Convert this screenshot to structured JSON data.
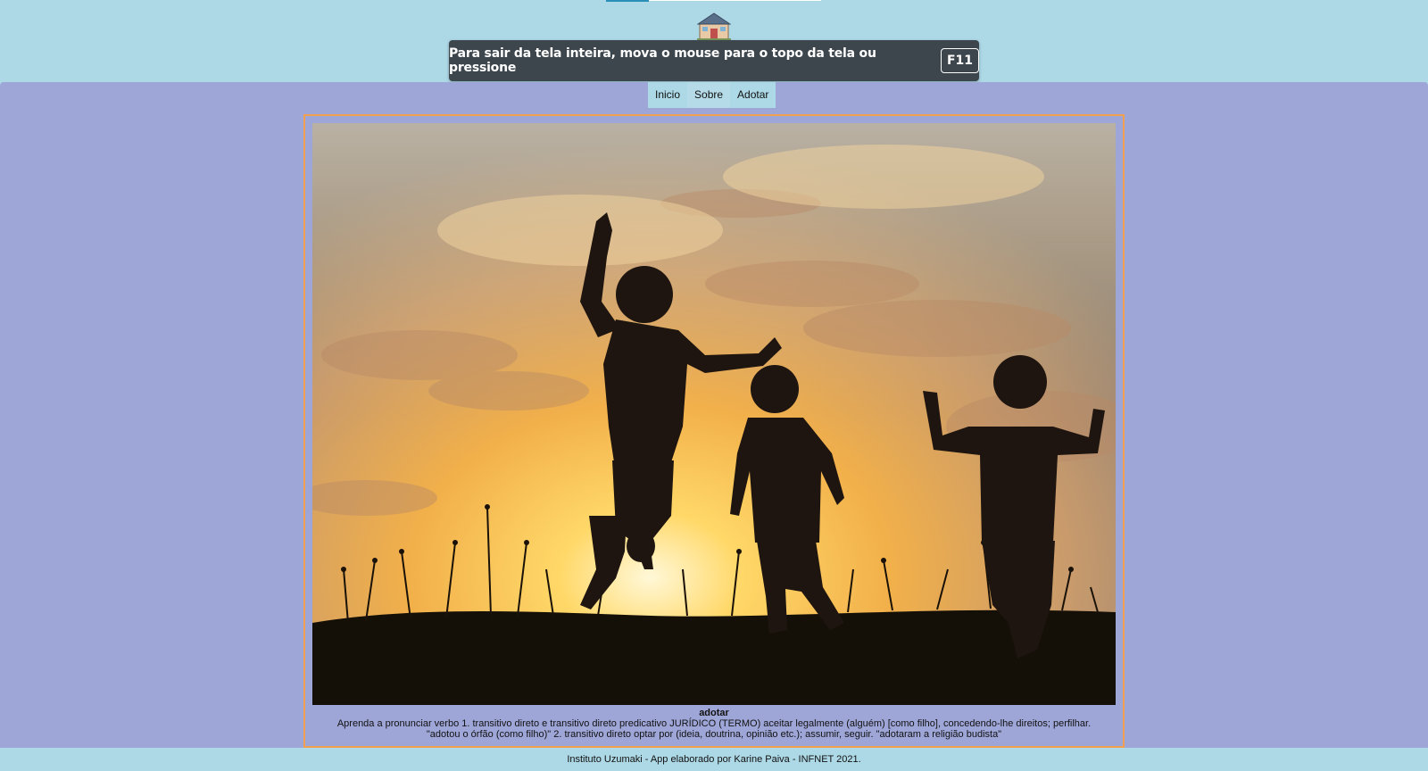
{
  "header": {
    "title": "Instituto Uzumaki",
    "logo_icon": "house-icon"
  },
  "fullscreen_notice": {
    "text": "Para sair da tela inteira, mova o mouse para o topo da tela ou pressione",
    "key": "F11"
  },
  "nav": {
    "items": [
      {
        "label": "Inicio"
      },
      {
        "label": "Sobre"
      },
      {
        "label": "Adotar"
      }
    ]
  },
  "hero": {
    "image": "children-silhouette-sunset-image"
  },
  "caption": {
    "title": "adotar",
    "text": "Aprenda a pronunciar verbo 1. transitivo direto e transitivo direto predicativo JURÍDICO (TERMO) aceitar legalmente (alguém) [como filho], concedendo-lhe direitos; perfilhar. \"adotou o órfão (como filho)\" 2. transitivo direto optar por (ideia, doutrina, opinião etc.); assumir, seguir. \"adotaram a religião budista\""
  },
  "footer": {
    "text": "Instituto Uzumaki - App elaborado por Karine Paiva - INFNET 2021."
  },
  "colors": {
    "header_bg": "#add8e6",
    "main_bg": "#9ea6d8",
    "frame_border": "#f0a050",
    "toast_bg": "#3d464d"
  }
}
